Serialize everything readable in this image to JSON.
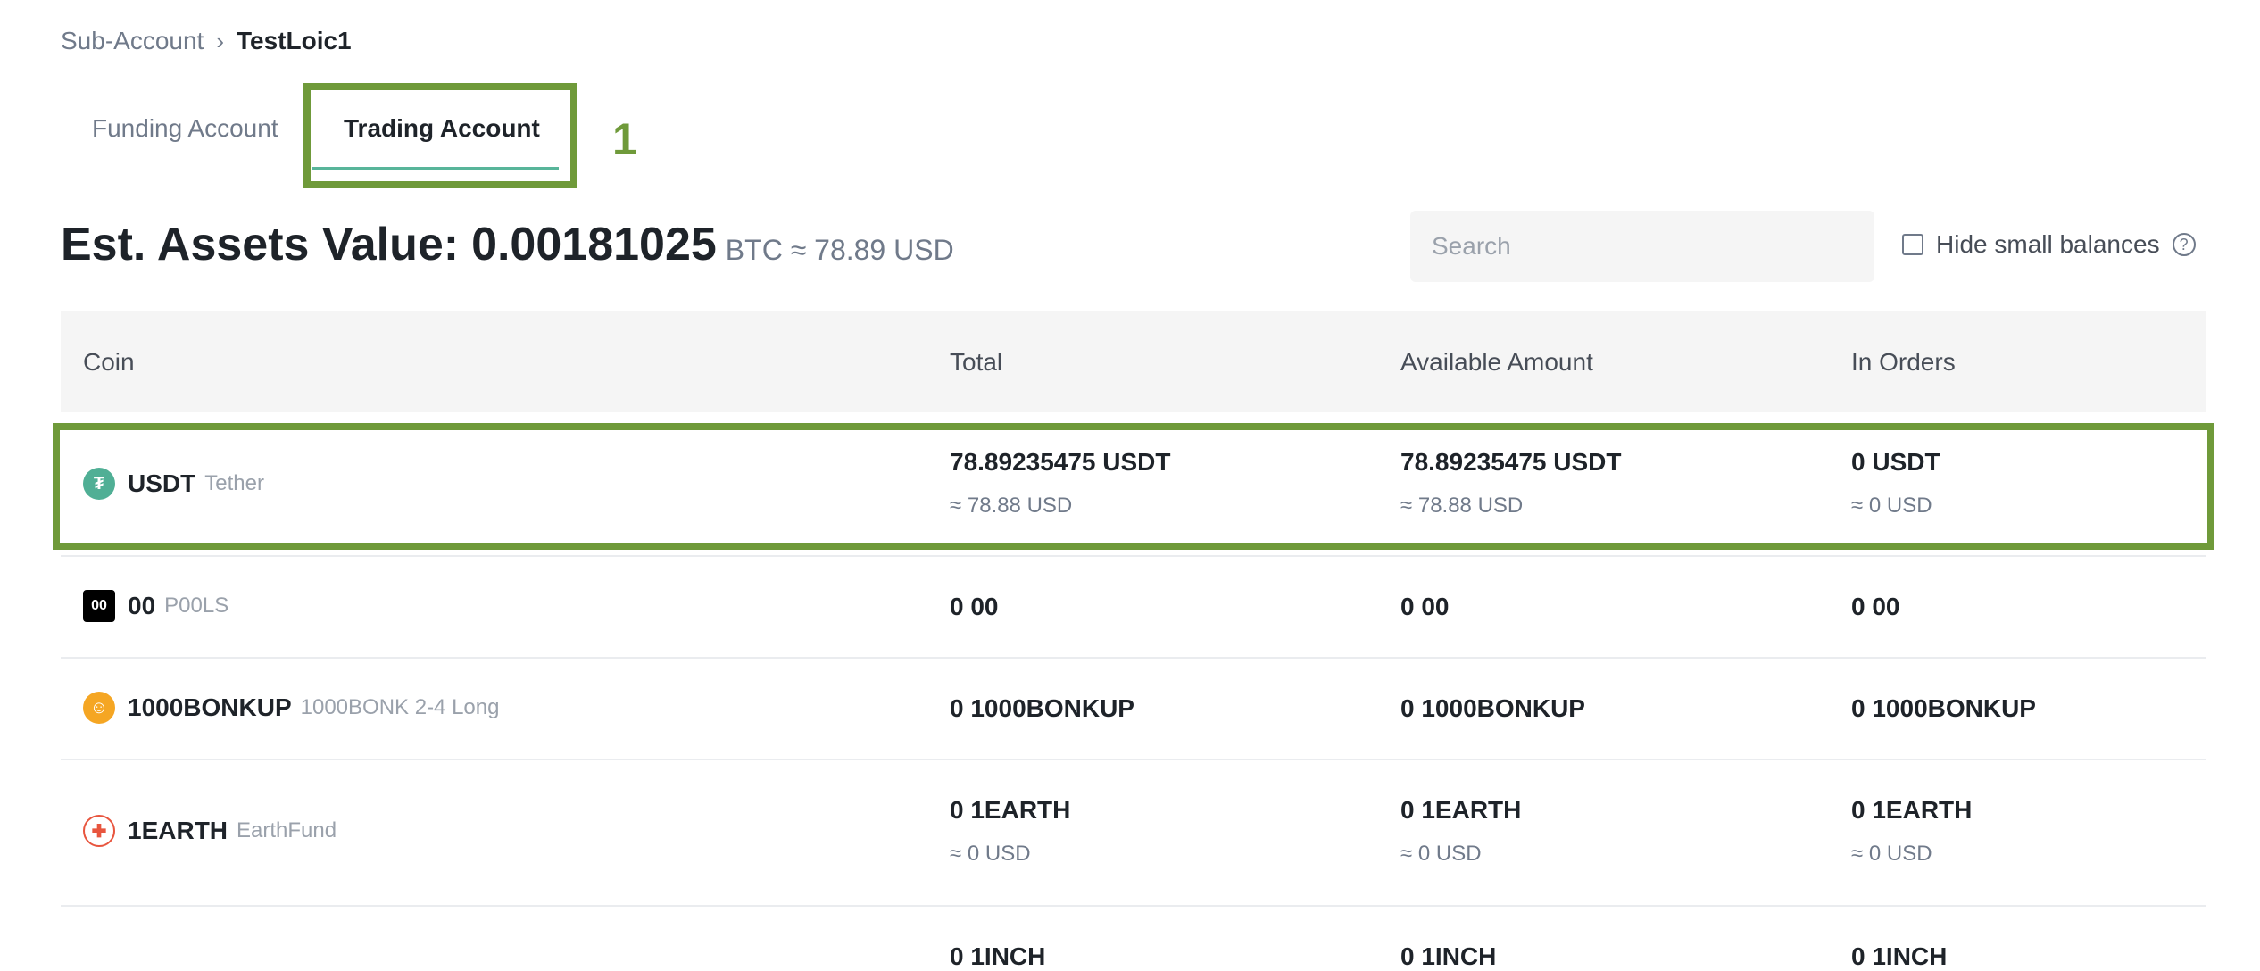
{
  "breadcrumb": {
    "parent": "Sub-Account",
    "current": "TestLoic1"
  },
  "tabs": [
    {
      "label": "Funding Account",
      "active": false
    },
    {
      "label": "Trading Account",
      "active": true
    }
  ],
  "annotation": {
    "label": "1",
    "color": "#6f9a3a"
  },
  "assets": {
    "label": "Est. Assets Value:",
    "value": "0.00181025",
    "unit_usd": "BTC ≈ 78.89 USD"
  },
  "search": {
    "placeholder": "Search",
    "value": ""
  },
  "hide_small": {
    "label": "Hide small balances",
    "checked": false,
    "help_icon": "question-circle-icon"
  },
  "table": {
    "headers": [
      "Coin",
      "Total",
      "Available Amount",
      "In Orders"
    ],
    "rows": [
      {
        "symbol": "USDT",
        "name": "Tether",
        "icon": "tether-icon",
        "icon_color": "#50af95",
        "total": "78.89235475 USDT",
        "total_usd": "≈ 78.88 USD",
        "available": "78.89235475 USDT",
        "available_usd": "≈ 78.88 USD",
        "in_orders": "0 USDT",
        "in_orders_usd": "≈ 0 USD"
      },
      {
        "symbol": "00",
        "name": "P00LS",
        "icon": "p00ls-icon",
        "icon_color": "#000000",
        "total": "0 00",
        "available": "0 00",
        "in_orders": "0 00"
      },
      {
        "symbol": "1000BONKUP",
        "name": "1000BONK 2-4 Long",
        "icon": "bonk-icon",
        "icon_color": "#f5a623",
        "total": "0 1000BONKUP",
        "available": "0 1000BONKUP",
        "in_orders": "0 1000BONKUP"
      },
      {
        "symbol": "1EARTH",
        "name": "EarthFund",
        "icon": "earthfund-icon",
        "icon_color": "#e8553e",
        "total": "0 1EARTH",
        "total_usd": "≈ 0 USD",
        "available": "0 1EARTH",
        "available_usd": "≈ 0 USD",
        "in_orders": "0 1EARTH",
        "in_orders_usd": "≈ 0 USD"
      },
      {
        "symbol": "",
        "name": "",
        "icon": "",
        "total": "0 1INCH",
        "available": "0 1INCH",
        "in_orders": "0 1INCH"
      }
    ]
  }
}
